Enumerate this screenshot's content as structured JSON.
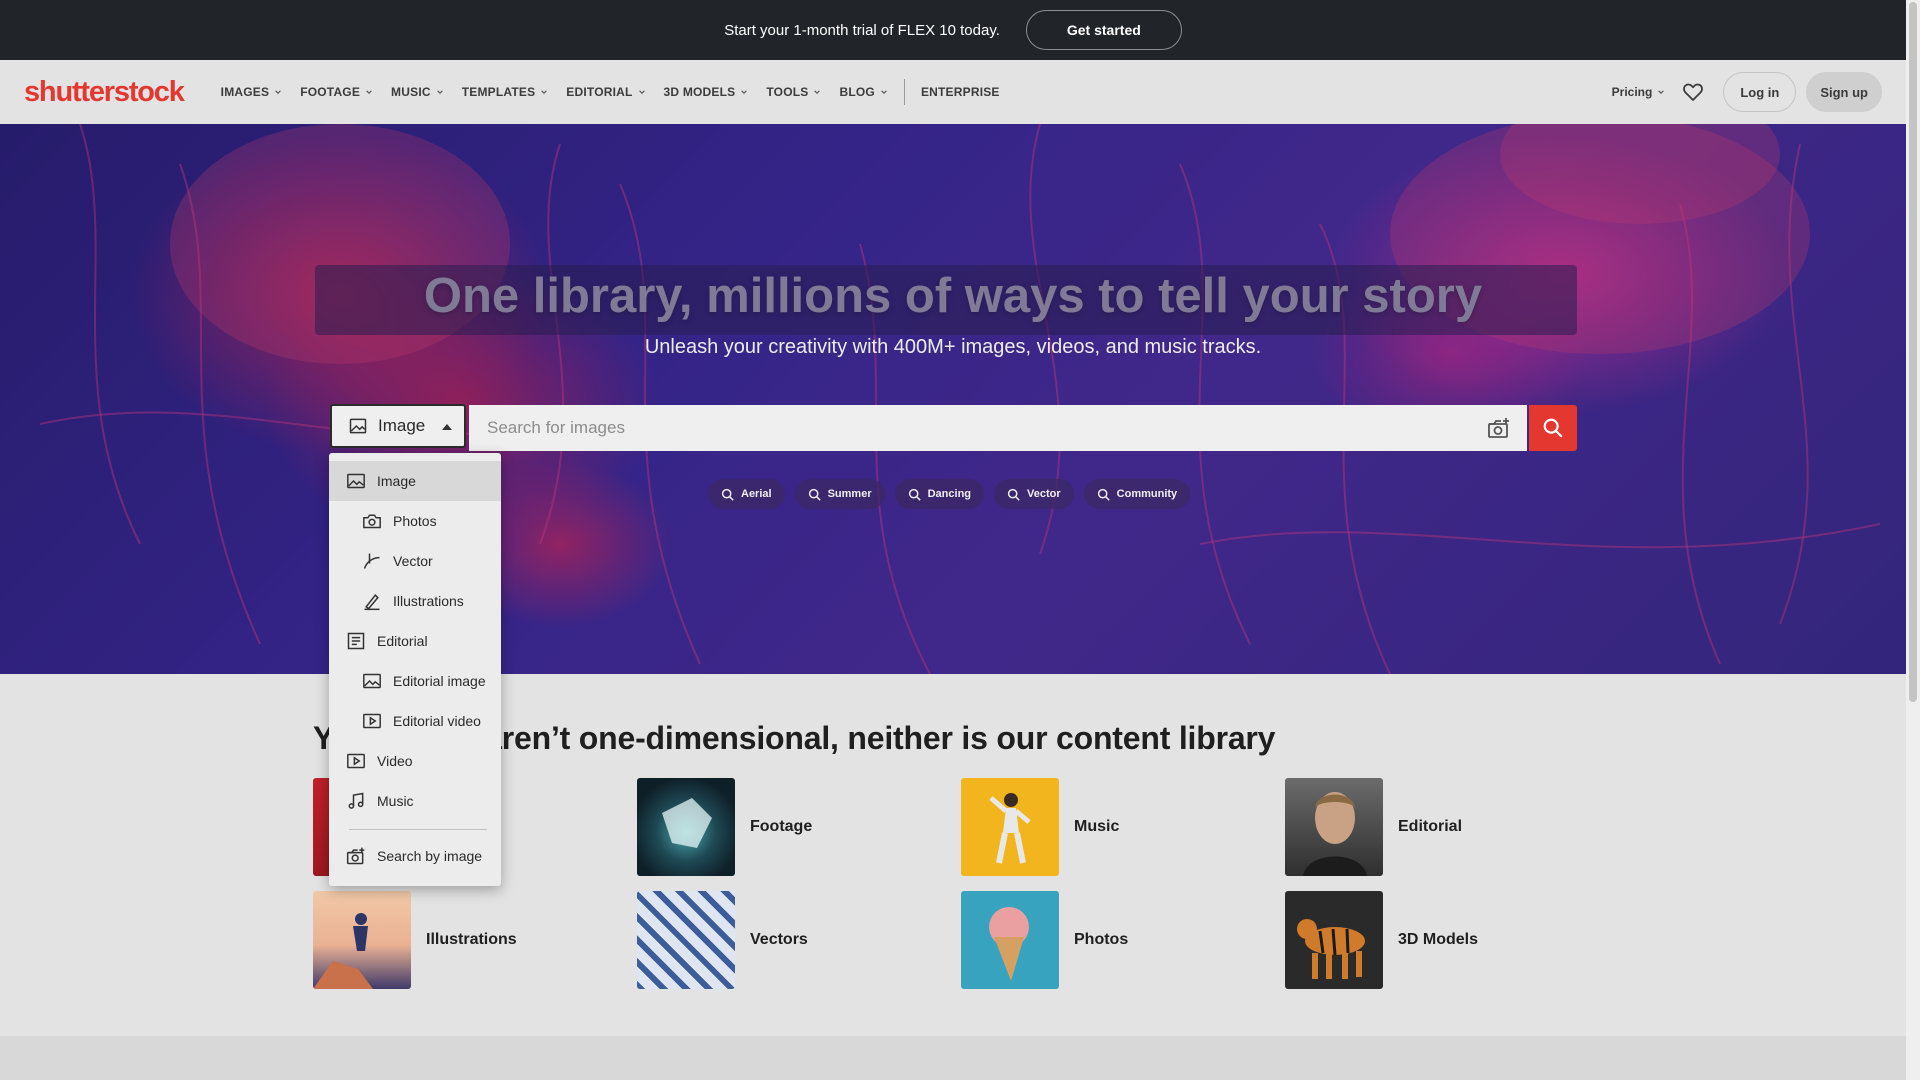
{
  "promo": {
    "text": "Start your 1-month trial of FLEX 10 today.",
    "cta": "Get started"
  },
  "brand": {
    "name_part1": "shutterst",
    "name_mark": "o",
    "name_part2": "ck",
    "color": "#e4372f"
  },
  "nav": {
    "items": [
      {
        "label": "IMAGES"
      },
      {
        "label": "FOOTAGE"
      },
      {
        "label": "MUSIC"
      },
      {
        "label": "TEMPLATES"
      },
      {
        "label": "EDITORIAL"
      },
      {
        "label": "3D MODELS"
      },
      {
        "label": "TOOLS"
      },
      {
        "label": "BLOG"
      }
    ],
    "enterprise": "ENTERPRISE",
    "pricing": "Pricing",
    "login": "Log in",
    "signup": "Sign up"
  },
  "hero": {
    "title": "One library, millions of ways to tell your story",
    "subtitle": "Unleash your creativity with 400M+ images, videos, and music tracks."
  },
  "search": {
    "type_selected": "Image",
    "placeholder": "Search for images",
    "accent": "#e4372f",
    "chips": [
      "Aerial",
      "Summer",
      "Dancing",
      "Vector",
      "Community"
    ]
  },
  "dropdown": {
    "items": [
      {
        "label": "Image",
        "icon": "image-icon"
      },
      {
        "label": "Photos",
        "icon": "camera-icon"
      },
      {
        "label": "Vector",
        "icon": "vector-pen-icon"
      },
      {
        "label": "Illustrations",
        "icon": "brush-icon"
      },
      {
        "label": "Editorial",
        "icon": "newspaper-icon"
      },
      {
        "label": "Editorial image",
        "icon": "image-icon"
      },
      {
        "label": "Editorial video",
        "icon": "video-icon"
      },
      {
        "label": "Video",
        "icon": "video-icon"
      },
      {
        "label": "Music",
        "icon": "music-note-icon"
      }
    ],
    "search_by_image": "Search by image"
  },
  "content": {
    "title_prefix": "Y",
    "title_rest": "aren’t one-dimensional, neither is our content library",
    "cards": [
      {
        "label": "Footage"
      },
      {
        "label": "Music"
      },
      {
        "label": "Editorial"
      },
      {
        "label": "Illustrations"
      },
      {
        "label": "Vectors"
      },
      {
        "label": "Photos"
      },
      {
        "label": "3D Models"
      }
    ]
  }
}
